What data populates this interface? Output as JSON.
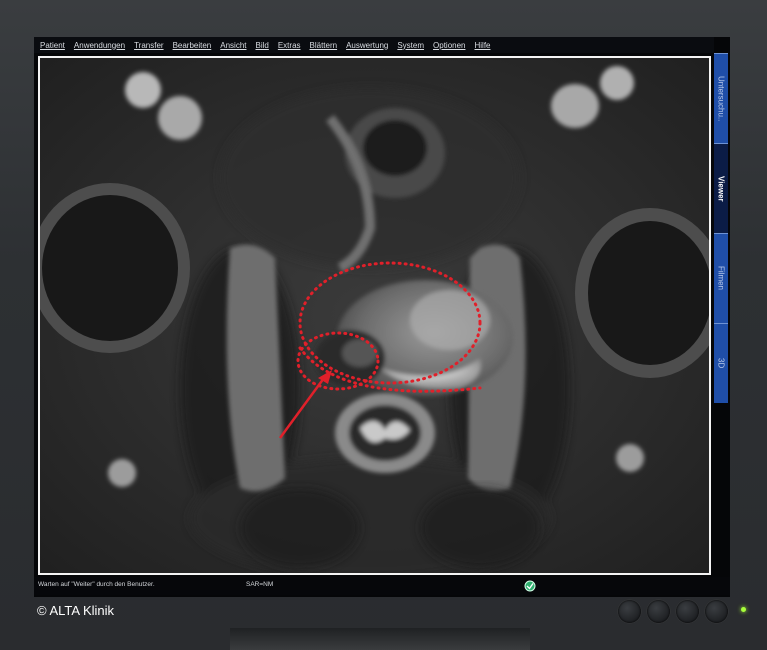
{
  "menu": {
    "items": [
      "Patient",
      "Anwendungen",
      "Transfer",
      "Bearbeiten",
      "Ansicht",
      "Bild",
      "Extras",
      "Blättern",
      "Auswertung",
      "System",
      "Optionen",
      "Hilfe"
    ]
  },
  "side_tabs": {
    "items": [
      "Untersuchu..",
      "Viewer",
      "Filmen",
      "3D"
    ],
    "active": "Viewer"
  },
  "status": {
    "message": "Warten auf \"Weiter\" durch den Benutzer.",
    "mode": "SAR=NM"
  },
  "footer": {
    "copyright": "© ALTA Klinik"
  },
  "colors": {
    "annotation": "#e0202a",
    "side_tab_bar": "#1f4ea8",
    "power_led": "#a8ff3a"
  },
  "image": {
    "type": "MRI axial pelvis (prostate)",
    "annotations": [
      "red dotted outline of prostate",
      "red dotted outline of lesion",
      "red arrow pointing to lesion"
    ]
  }
}
